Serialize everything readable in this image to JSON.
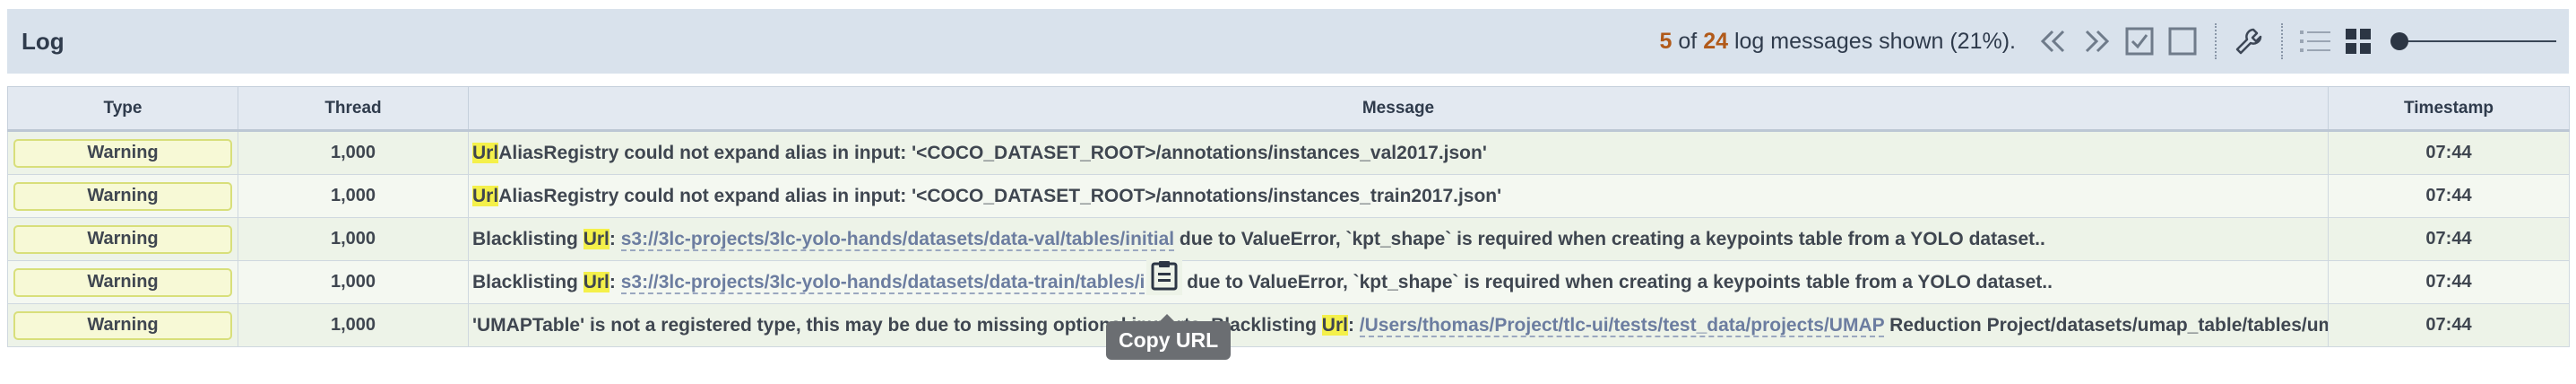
{
  "header": {
    "title": "Log",
    "shown_count": "5",
    "of_text": "of",
    "total_count": "24",
    "suffix": "log messages shown (21%)."
  },
  "toolbar": {
    "icons": [
      "chevrons-left-icon",
      "chevrons-right-icon",
      "checkbox-checked-icon",
      "checkbox-empty-icon",
      "wrench-icon",
      "list-view-icon",
      "grid-view-icon"
    ],
    "slider_value": 0
  },
  "table": {
    "columns": [
      "Type",
      "Thread",
      "Message",
      "Timestamp"
    ],
    "rows": [
      {
        "type": "Warning",
        "thread": "1,000",
        "msg_pre": "",
        "msg_hl": "Url",
        "msg_mid": "AliasRegistry could not expand alias in input: '<COCO_DATASET_ROOT>/annotations/instances_val2017.json'",
        "msg_url": "",
        "msg_post": "",
        "timestamp": "07:44"
      },
      {
        "type": "Warning",
        "thread": "1,000",
        "msg_pre": "",
        "msg_hl": "Url",
        "msg_mid": "AliasRegistry could not expand alias in input: '<COCO_DATASET_ROOT>/annotations/instances_train2017.json'",
        "msg_url": "",
        "msg_post": "",
        "timestamp": "07:44"
      },
      {
        "type": "Warning",
        "thread": "1,000",
        "msg_pre": "Blacklisting ",
        "msg_hl": "Url",
        "msg_mid": ": ",
        "msg_url": "s3://3lc-projects/3lc-yolo-hands/datasets/data-val/tables/initial",
        "msg_post": " due to ValueError, `kpt_shape` is required when creating a keypoints table from a YOLO dataset..",
        "timestamp": "07:44"
      },
      {
        "type": "Warning",
        "thread": "1,000",
        "msg_pre": "Blacklisting ",
        "msg_hl": "Url",
        "msg_mid": ": ",
        "msg_url": "s3://3lc-projects/3lc-yolo-hands/datasets/data-train/tables/i",
        "msg_post": "        due to ValueError, `kpt_shape` is required when creating a keypoints table from a YOLO dataset..",
        "timestamp": "07:44"
      },
      {
        "type": "Warning",
        "thread": "1,000",
        "msg_pre": "'UMAPTable' is not a registered type, this may be due to missing optional imports. Blacklisting ",
        "msg_hl": "Url",
        "msg_mid": ": ",
        "msg_url": "/Users/thomas/Project/tlc-ui/tests/test_data/projects/UMAP",
        "msg_post": " Reduction Project/datasets/umap_table/tables/umap_t",
        "timestamp": "07:44"
      }
    ]
  },
  "tooltip": {
    "text": "Copy URL"
  }
}
